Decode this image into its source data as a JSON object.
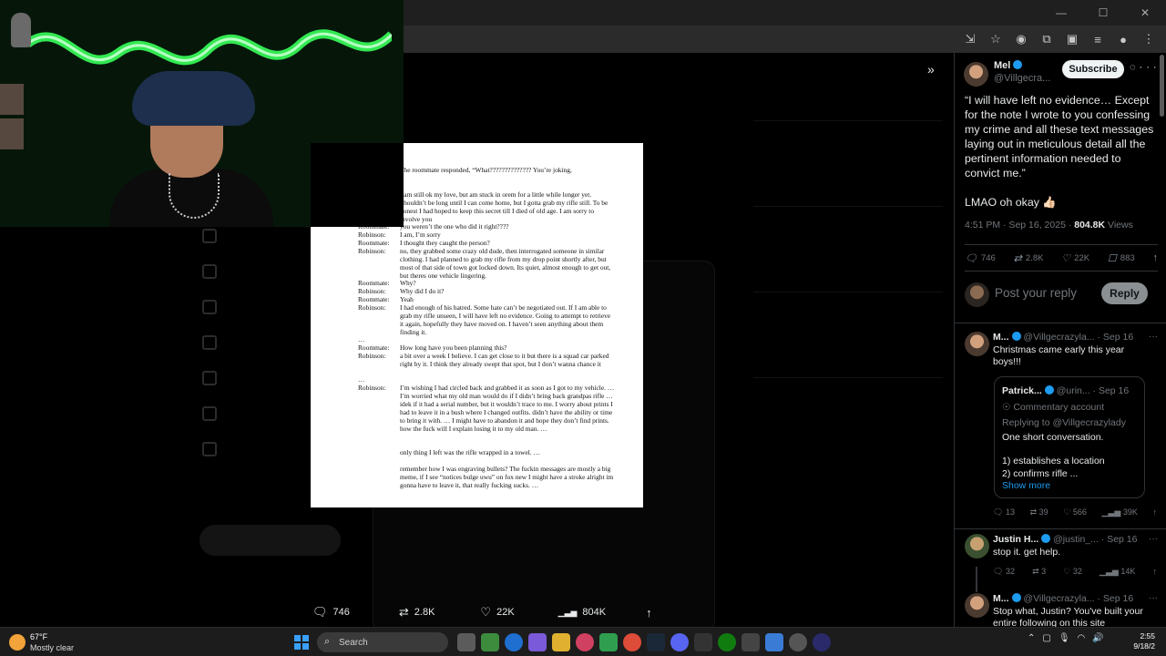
{
  "document": {
    "lines": [
      {
        "speaker": "",
        "text": "The roommate responded, “What?????????????? You’re joking,"
      },
      {
        "speaker": "",
        "text": "I am still ok my love, but am stuck in orem for a little while longer yet. Shouldn’t be long until I can come home, but I gotta grab my rifle still. To be honest I had hoped to keep this secret till I died of old age. I am sorry to involve you"
      },
      {
        "speaker": "Roommate:",
        "text": "you weren’t the one who did it right????"
      },
      {
        "speaker": "Robinson:",
        "text": "I am, I’m sorry"
      },
      {
        "speaker": "Roommate:",
        "text": "I thought they caught the person?"
      },
      {
        "speaker": "Robinson:",
        "text": "no, they grabbed some crazy old dude, then interrogated someone in similar clothing. I had planned to grab my rifle from my drop point shortly after, but most of that side of town got locked down. Its quiet, almost enough to get out, but theres one vehicle lingering."
      },
      {
        "speaker": "Roommate:",
        "text": "Why?"
      },
      {
        "speaker": "Robinson:",
        "text": "Why did I do it?"
      },
      {
        "speaker": "Roommate:",
        "text": "Yeah"
      },
      {
        "speaker": "Robinson:",
        "text": "I had enough of his hatred. Some hate can’t be negotiated out. If I am able to grab my rifle unseen, I will have left no evidence. Going to attempt to retrieve it again, hopefully they have moved on. I haven’t seen anything about them finding it."
      },
      {
        "speaker": "…",
        "text": ""
      },
      {
        "speaker": "Roommate:",
        "text": "How long have you been planning this?"
      },
      {
        "speaker": "Robinson:",
        "text": "a bit over a week I believe. I can get close to it but there is a squad car parked right by it. I think they already swept that spot, but I don’t wanna chance it"
      },
      {
        "speaker": "…",
        "text": ""
      },
      {
        "speaker": "Robinson:",
        "text": "I’m wishing I had circled back and grabbed it as soon as I got to my vehicle. … I’m worried what my old man would do if I didn’t bring back grandpas rifle … idek if it had a serial number, but it wouldn’t trace to me. I worry about prints I had to leave it in a bush where I changed outfits. didn’t have the ability or time to bring it with. … I might have to abandon it and hope they don’t find prints. how the fuck will I explain losing it to my old man. …"
      },
      {
        "speaker": "",
        "text": "only thing I left was the rifle wrapped in a towel. …"
      },
      {
        "speaker": "",
        "text": "remember how I was engraving bullets? The fuckin messages are mostly a big meme, if I see “notices bulge uwu” on fox new I might have a stroke alright im gonna have to leave it, that really fucking sucks. …"
      }
    ]
  },
  "actionbar": {
    "replies": "746",
    "reposts": "2.8K",
    "likes": "22K",
    "views": "804K"
  },
  "panel": {
    "main": {
      "name": "Mel",
      "handle": "@Villgecra...",
      "subscribe_label": "Subscribe",
      "text_quote": "“I will have left no evidence… Except for the note I wrote to you confessing my crime and all these text messages laying out in meticulous detail all the pertinent information needed to convict me.”",
      "text_reply": "LMAO oh okay 👍🏻",
      "time": "4:51 PM · Sep 16, 2025 ·",
      "views_count": "804.8K",
      "views_label": " Views",
      "stats": {
        "replies": "746",
        "reposts": "2.8K",
        "likes": "22K",
        "bookmarks": "883"
      }
    },
    "reply_placeholder": "Post your reply",
    "reply_button": "Reply",
    "replies": [
      {
        "name": "M...",
        "handle": "@Villgecrazyla...",
        "date": "· Sep 16",
        "text": "Christmas came early this year boys!!!",
        "stats": {
          "replies": "13",
          "reposts": "39",
          "likes": "566",
          "views": "39K"
        },
        "quote": {
          "name": "Patrick...",
          "handle": "@urin...",
          "date": "· Sep 16",
          "account_type": "Commentary account",
          "replying_to": "Replying to @Villgecrazylady",
          "line1": "One short conversation.",
          "line2": "1) establishes a location",
          "line3": "2) confirms rifle ...",
          "show_more": "Show more"
        }
      },
      {
        "name": "Justin H...",
        "handle": "@justin_...",
        "date": "· Sep 16",
        "text": "stop it. get help.",
        "stats": {
          "replies": "32",
          "reposts": "3",
          "likes": "32",
          "views": "14K"
        }
      },
      {
        "name": "M...",
        "handle": "@Villgecrazyla...",
        "date": "· Sep 16",
        "text": "Stop what, Justin? You've built your entire following on this site"
      }
    ]
  },
  "taskbar": {
    "weather_temp": "67°F",
    "weather_desc": "Mostly clear",
    "search_label": "Search",
    "time": "2:55",
    "date": "9/18/2"
  },
  "icons": {
    "reply": "🗨",
    "repost": "⇄",
    "like": "♡",
    "views": "▁▃▅",
    "share": "↑",
    "bookmark": "☐"
  }
}
